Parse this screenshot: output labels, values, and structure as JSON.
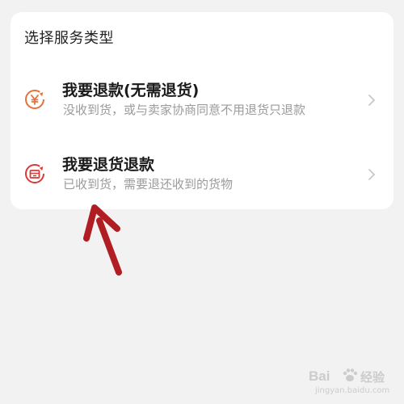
{
  "card": {
    "title": "选择服务类型"
  },
  "options": [
    {
      "title": "我要退款(无需退货)",
      "subtitle": "没收到货，或与卖家协商同意不用退货只退款",
      "icon": "yen-refund-icon",
      "icon_color": "#e8703a"
    },
    {
      "title": "我要退货退款",
      "subtitle": "已收到货，需要退还收到的货物",
      "icon": "return-goods-icon",
      "icon_color": "#d83a3a"
    }
  ],
  "watermark": {
    "brand": "Bai",
    "brand_suffix": "经验",
    "sub": "jingyan.baidu.com"
  },
  "colors": {
    "background": "#f2f2f2",
    "card": "#ffffff",
    "annotation_arrow": "#b01e24"
  }
}
